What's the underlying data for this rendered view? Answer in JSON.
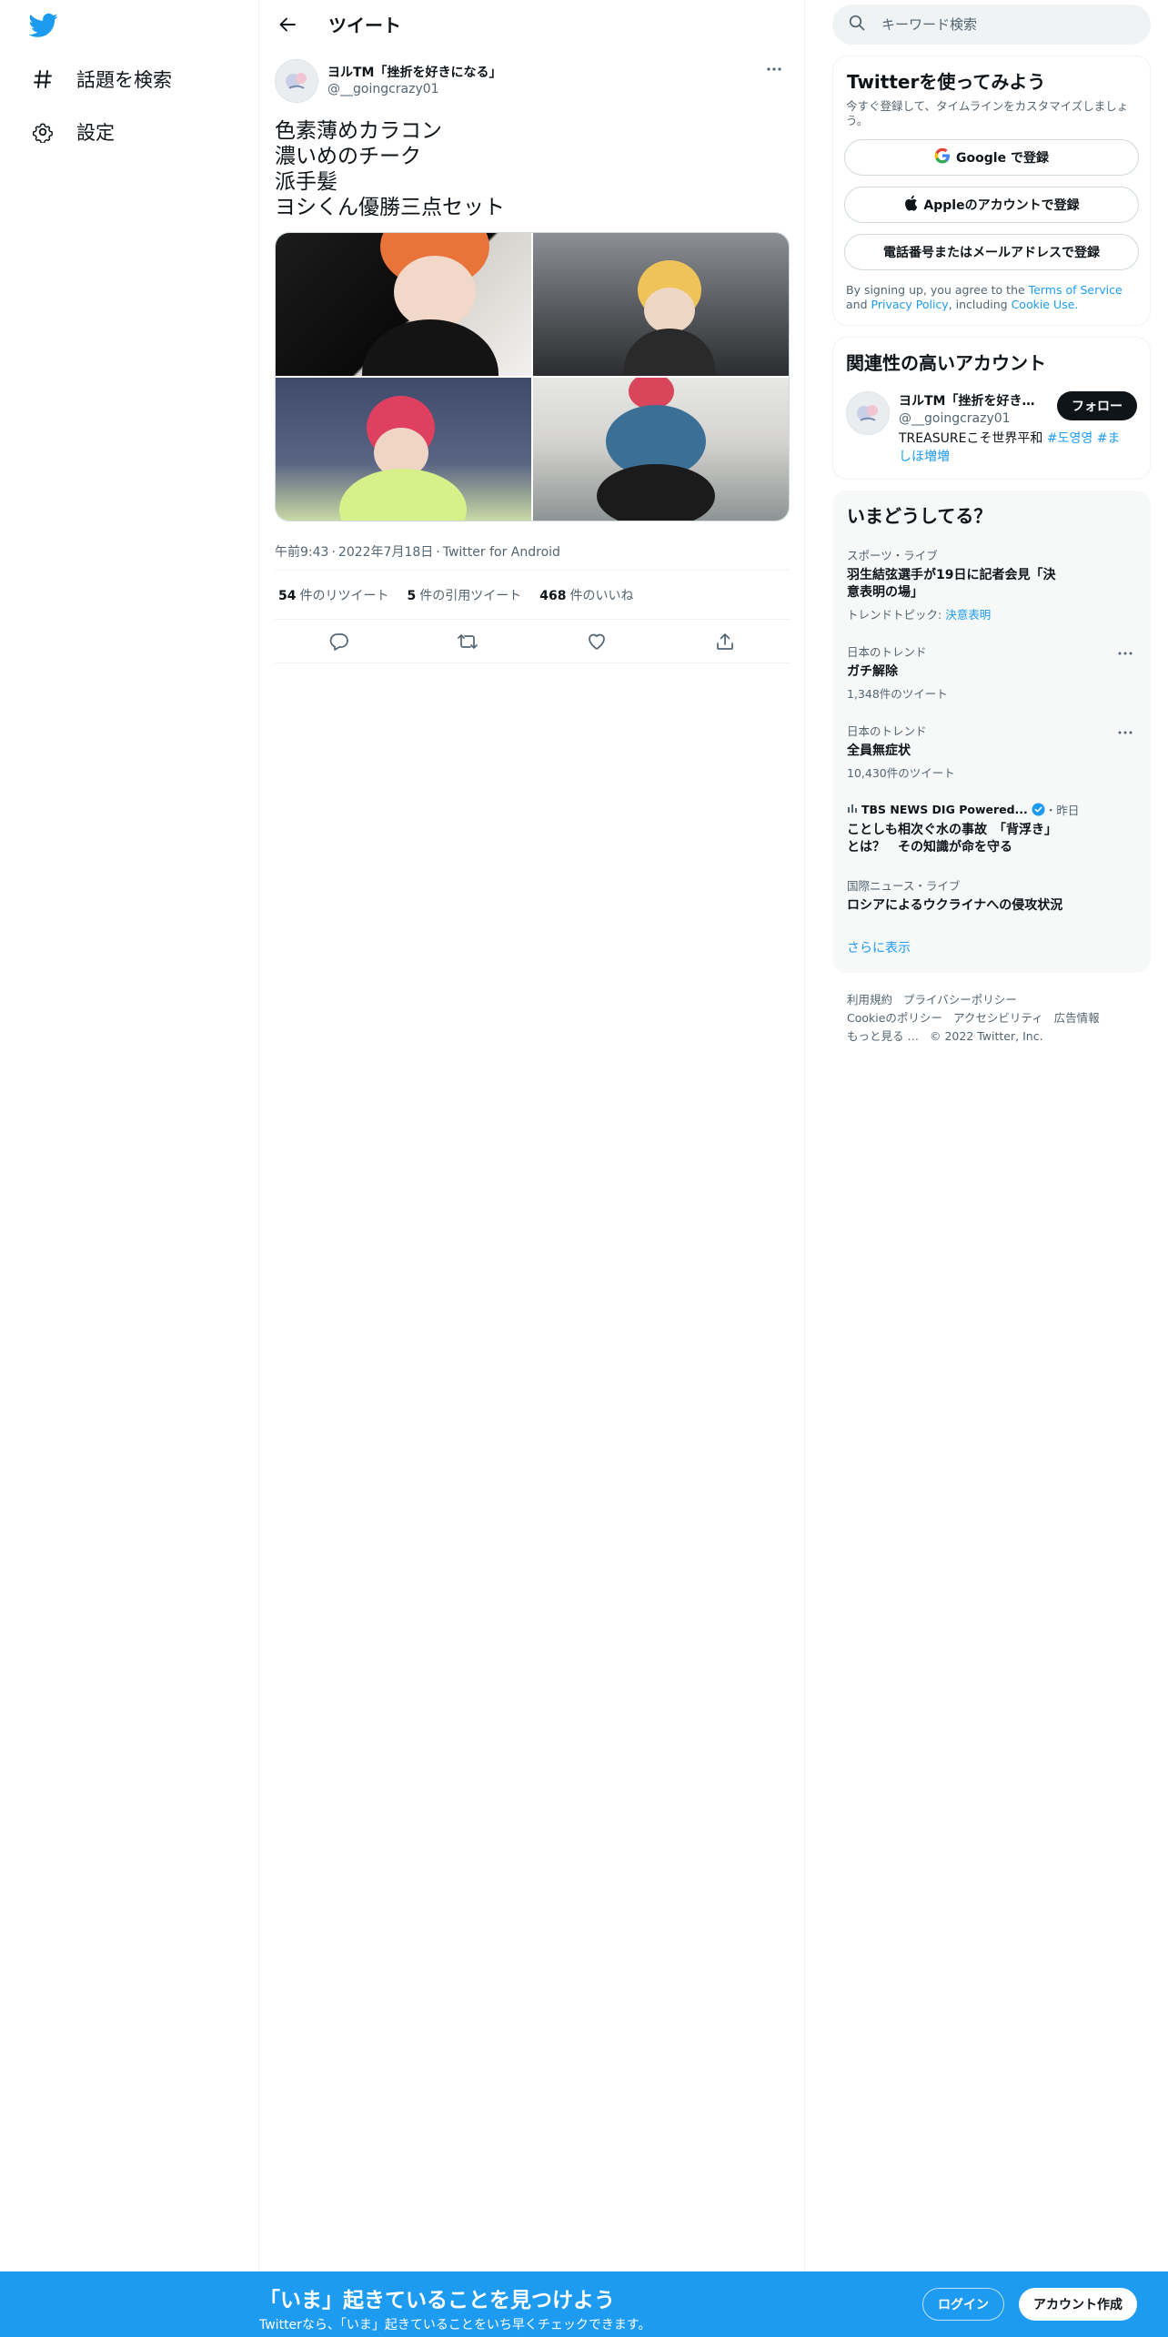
{
  "nav": {
    "items": [
      {
        "label": "話題を検索",
        "icon": "hashtag-icon"
      },
      {
        "label": "設定",
        "icon": "gear-icon"
      }
    ]
  },
  "header": {
    "title": "ツイート"
  },
  "tweet": {
    "author_name": "ヨルTM「挫折を好きになる」",
    "author_handle": "@__goingcrazy01",
    "text_lines": [
      "色素薄めカラコン",
      "濃いめのチーク",
      "派手髪",
      "ヨシくん優勝三点セット"
    ],
    "time": "午前9:43",
    "date": "2022年7月18日",
    "client": "Twitter for Android",
    "retweets_count": "54",
    "retweets_label": "件のリツイート",
    "quotes_count": "5",
    "quotes_label": "件の引用ツイート",
    "likes_count": "468",
    "likes_label": "件のいいね"
  },
  "search": {
    "placeholder": "キーワード検索"
  },
  "signup": {
    "title": "Twitterを使ってみよう",
    "subtitle": "今すぐ登録して、タイムラインをカスタマイズしましょう。",
    "google_label": "Google で登録",
    "apple_label": "Appleのアカウントで登録",
    "phone_label": "電話番号またはメールアドレスで登録",
    "legal_prefix": "By signing up, you agree to the",
    "terms_label": "Terms of Service",
    "legal_and": "and",
    "privacy_label": "Privacy Policy",
    "legal_including": ", including",
    "cookie_label": "Cookie Use."
  },
  "related": {
    "title": "関連性の高いアカウント",
    "name": "ヨルTM「挫折を好きになる」",
    "handle": "@__goingcrazy01",
    "bio_text": "TREASUREこそ世界平和 ",
    "bio_tags": [
      "#도영영",
      "#ましほ増増"
    ],
    "follow_label": "フォロー"
  },
  "trends": {
    "title": "いまどうしてる？",
    "items": [
      {
        "category": "スポーツ・ライブ",
        "name": "羽生結弦選手が19日に記者会見「決意表明の場」",
        "extra_prefix": "トレンドトピック: ",
        "extra_link": "決意表明"
      },
      {
        "category": "日本のトレンド",
        "name": "ガチ解除",
        "extra": "1,348件のツイート"
      },
      {
        "category": "日本のトレンド",
        "name": "全員無症状",
        "extra": "10,430件のツイート"
      },
      {
        "source": "TBS NEWS DIG Powered...",
        "time": "・昨日",
        "name": "ことしも相次ぐ水の事故　「背浮き」とは？　その知識が命を守る"
      },
      {
        "category": "国際ニュース・ライブ",
        "name": "ロシアによるウクライナへの侵攻状況"
      }
    ],
    "show_more": "さらに表示"
  },
  "footer": {
    "links": [
      "利用規約",
      "プライバシーポリシー",
      "Cookieのポリシー",
      "アクセシビリティ",
      "広告情報",
      "もっと見る …"
    ],
    "copyright": "© 2022 Twitter, Inc."
  },
  "bottom_bar": {
    "title": "「いま」起きていることを見つけよう",
    "subtitle": "Twitterなら、「いま」起きていることをいち早くチェックできます。",
    "login_label": "ログイン",
    "signup_label": "アカウント作成"
  },
  "colors": {
    "accent": "#1d9bf0",
    "text": "#0f1419",
    "muted": "#536471",
    "panel": "#f7f9f9"
  }
}
